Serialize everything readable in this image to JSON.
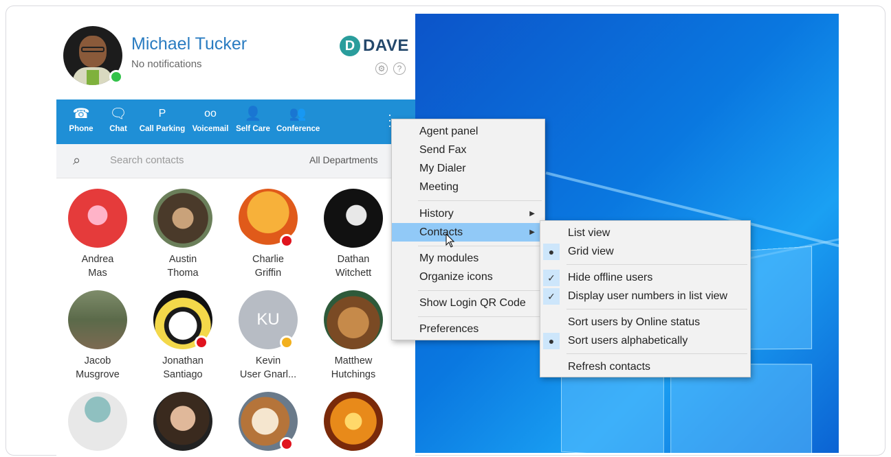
{
  "profile": {
    "name": "Michael Tucker",
    "status": "No notifications",
    "brand_letter": "D",
    "brand_name": "DAVE",
    "settings_icon": "gear-icon",
    "help_icon": "help-icon"
  },
  "toolbar": {
    "items": [
      {
        "label": "Phone",
        "icon": "phone-icon",
        "glyph": "☎"
      },
      {
        "label": "Chat",
        "icon": "chat-icon",
        "glyph": "🗨"
      },
      {
        "label": "Call Parking",
        "icon": "parking-icon",
        "glyph": "P"
      },
      {
        "label": "Voicemail",
        "icon": "voicemail-icon",
        "glyph": "oo"
      },
      {
        "label": "Self Care",
        "icon": "self-care-icon",
        "glyph": "👤"
      },
      {
        "label": "Conference",
        "icon": "conference-icon",
        "glyph": "👥"
      }
    ],
    "more_icon": "more-icon"
  },
  "search": {
    "placeholder": "Search contacts",
    "department": "All Departments"
  },
  "contacts": [
    {
      "name1": "Andrea",
      "name2": "Mas",
      "status": "none"
    },
    {
      "name1": "Austin",
      "name2": "Thoma",
      "status": "none"
    },
    {
      "name1": "Charlie",
      "name2": "Griffin",
      "status": "busy"
    },
    {
      "name1": "Dathan",
      "name2": "Witchett",
      "status": "none"
    },
    {
      "name1": "Jacob",
      "name2": "Musgrove",
      "status": "none"
    },
    {
      "name1": "Jonathan",
      "name2": "Santiago",
      "status": "on-call"
    },
    {
      "name1": "Kevin",
      "name2": "User Gnarl...",
      "initials": "KU",
      "status": "away"
    },
    {
      "name1": "Matthew",
      "name2": "Hutchings",
      "status": "none"
    },
    {
      "name1": "",
      "name2": "",
      "status": "none"
    },
    {
      "name1": "",
      "name2": "",
      "status": "none"
    },
    {
      "name1": "",
      "name2": "",
      "status": "on-call"
    },
    {
      "name1": "",
      "name2": "",
      "status": "none"
    }
  ],
  "main_menu": {
    "items": [
      "Agent panel",
      "Send Fax",
      "My Dialer",
      "Meeting",
      "History",
      "Contacts",
      "My modules",
      "Organize icons",
      "Show Login QR Code",
      "Preferences"
    ],
    "highlighted": "Contacts"
  },
  "contacts_submenu": {
    "items": [
      "List view",
      "Grid view",
      "Hide offline users",
      "Display user numbers in list view",
      "Sort users by Online status",
      "Sort users alphabetically",
      "Refresh contacts"
    ],
    "checked": [
      "Hide offline users",
      "Display user numbers in list view"
    ],
    "selected_radio": [
      "Grid view",
      "Sort users alphabetically"
    ]
  },
  "colors": {
    "accent": "#1f8fd6",
    "name_blue": "#2a7cc1",
    "online": "#33c24a",
    "busy": "#e0141e",
    "away": "#f2b01e",
    "menu_highlight": "#91c9f7"
  }
}
